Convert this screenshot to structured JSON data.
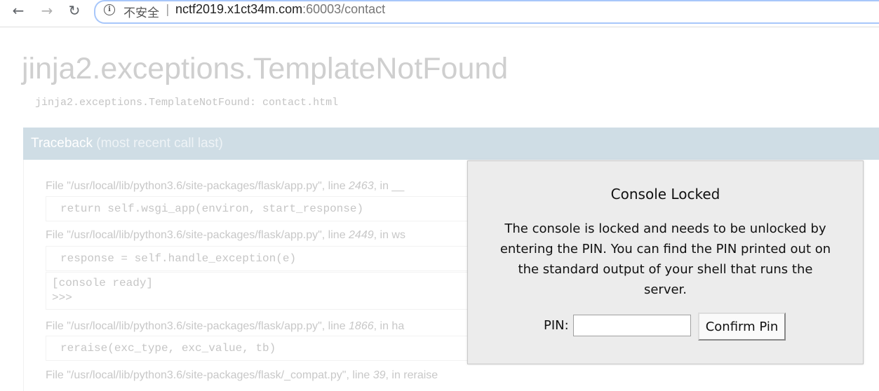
{
  "browser": {
    "back_icon": "←",
    "forward_icon": "→",
    "reload_icon": "↻",
    "info_icon": "i",
    "security_text": "不安全",
    "separator": "|",
    "url_host": "nctf2019.x1ct34m.com",
    "url_path": ":60003/contact"
  },
  "error": {
    "title": "jinja2.exceptions.TemplateNotFound",
    "message": "jinja2.exceptions.TemplateNotFound: contact.html"
  },
  "traceback": {
    "header": "Traceback",
    "header_sub": "(most recent call last)",
    "frames": [
      {
        "file_prefix": "File \"",
        "path": "/usr/local/lib/python3.6/site-packages/flask/app.py",
        "line_label": "\", line ",
        "line": "2463",
        "in_label": ", in ",
        "func": "__",
        "code": "return self.wsgi_app(environ, start_response)"
      },
      {
        "file_prefix": "File \"",
        "path": "/usr/local/lib/python3.6/site-packages/flask/app.py",
        "line_label": "\", line ",
        "line": "2449",
        "in_label": ", in ",
        "func": "ws",
        "code": "response = self.handle_exception(e)"
      },
      {
        "file_prefix": "File \"",
        "path": "/usr/local/lib/python3.6/site-packages/flask/app.py",
        "line_label": "\", line ",
        "line": "1866",
        "in_label": ", in ",
        "func": "ha",
        "code": "reraise(exc_type, exc_value, tb)"
      },
      {
        "file_prefix": "File \"",
        "path": "/usr/local/lib/python3.6/site-packages/flask/_compat.py",
        "line_label": "\", line ",
        "line": "39",
        "in_label": ", in ",
        "func": "reraise",
        "code": ""
      }
    ],
    "console_line1": "[console ready]",
    "console_line2": ">>>"
  },
  "modal": {
    "title": "Console Locked",
    "text": "The console is locked and needs to be unlocked by entering the PIN. You can find the PIN printed out on the standard output of your shell that runs the server.",
    "pin_label": "PIN:",
    "pin_value": "",
    "confirm_label": "Confirm Pin"
  }
}
